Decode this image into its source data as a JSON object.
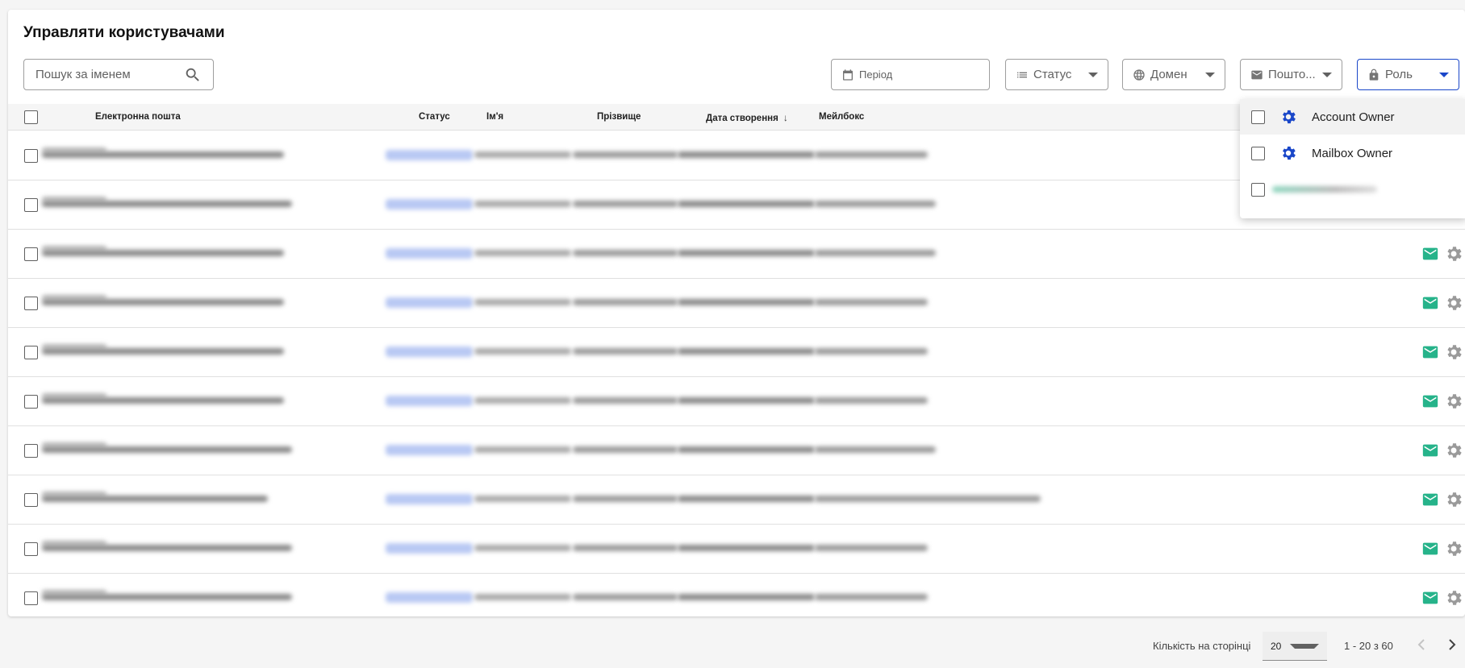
{
  "page": {
    "title": "Управляти користувачами"
  },
  "search": {
    "placeholder": "Пошук за іменем",
    "icon": "search-icon"
  },
  "filters": {
    "period": {
      "label": "Період",
      "icon": "calendar-icon"
    },
    "status": {
      "label": "Статус",
      "icon": "list-icon"
    },
    "domain": {
      "label": "Домен",
      "icon": "globe-icon"
    },
    "mail": {
      "label": "Пошто...",
      "icon": "mail-icon"
    },
    "role": {
      "label": "Роль",
      "icon": "lock-icon"
    }
  },
  "table": {
    "columns": {
      "email": "Електронна пошта",
      "status": "Статус",
      "first_name": "Ім'я",
      "last_name": "Прізвище",
      "created": "Дата створення",
      "mailbox": "Мейлбокс"
    },
    "sort": {
      "column": "created",
      "direction": "desc"
    },
    "row_action_icons": [
      "mail-icon",
      "gear-icon"
    ]
  },
  "role_dropdown": {
    "options": [
      {
        "label": "Account Owner",
        "icon": "gear-icon"
      },
      {
        "label": "Mailbox Owner",
        "icon": "gear-icon"
      }
    ]
  },
  "pagination": {
    "per_page_label": "Кількість на сторінці",
    "per_page_value": "20",
    "range": "1 - 20 з 60"
  },
  "colors": {
    "accent": "#1a47c9",
    "mail_icon": "#26b38a",
    "status_chip": "#b8c8f3"
  }
}
